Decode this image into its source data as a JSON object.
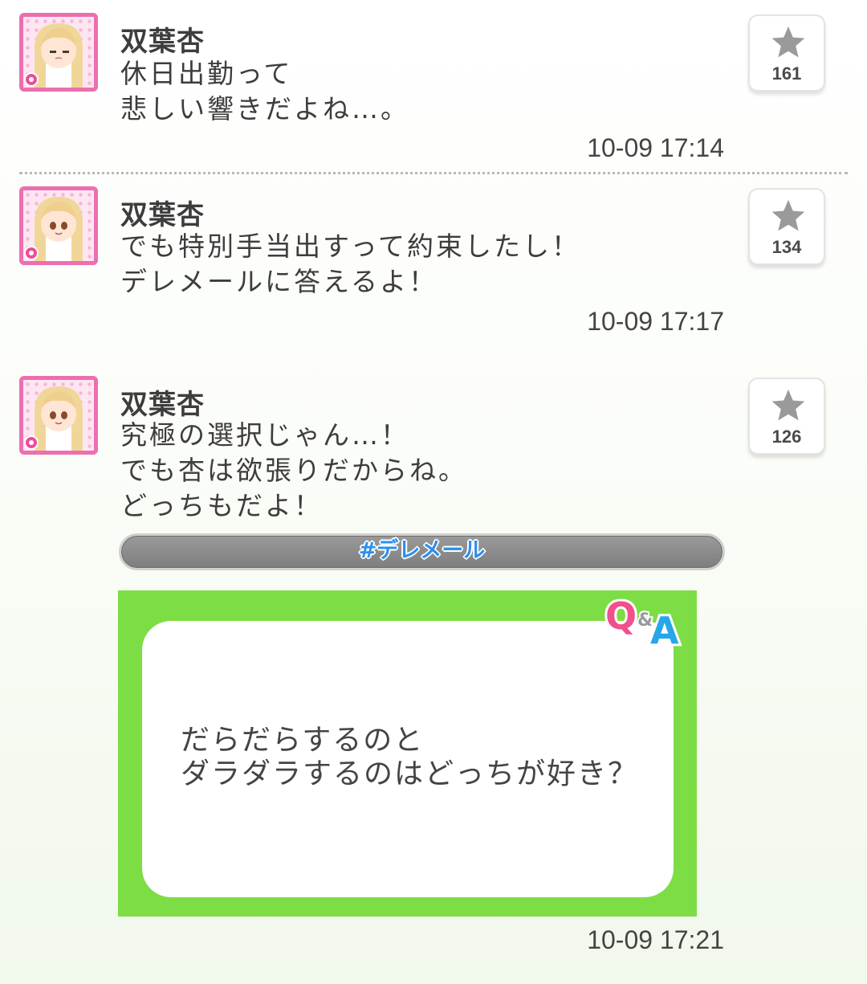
{
  "posts": [
    {
      "author": "双葉杏",
      "lines": [
        "休日出勤って",
        "悲しい響きだよね…。"
      ],
      "timestamp": "10-09 17:14",
      "favorite_count": "161"
    },
    {
      "author": "双葉杏",
      "lines": [
        "でも特別手当出すって約束したし！",
        "デレメールに答えるよ！"
      ],
      "timestamp": "10-09 17:17",
      "favorite_count": "134"
    },
    {
      "author": "双葉杏",
      "lines": [
        "究極の選択じゃん…！",
        "でも杏は欲張りだからね。",
        "どっちもだよ！"
      ],
      "timestamp": "10-09 17:21",
      "favorite_count": "126",
      "hashtag": "#デレメール",
      "qa_card": {
        "logo_q": "Q",
        "logo_amp": "&",
        "logo_a": "A",
        "question_lines": [
          "だらだらするのと",
          "ダラダラするのはどっちが好き？"
        ]
      }
    }
  ],
  "colors": {
    "avatar_border": "#ec6fb0",
    "qa_card_background": "#7ddd45",
    "hashtag_text": "#2d8ff0",
    "star_icon": "#9a9a9a"
  }
}
